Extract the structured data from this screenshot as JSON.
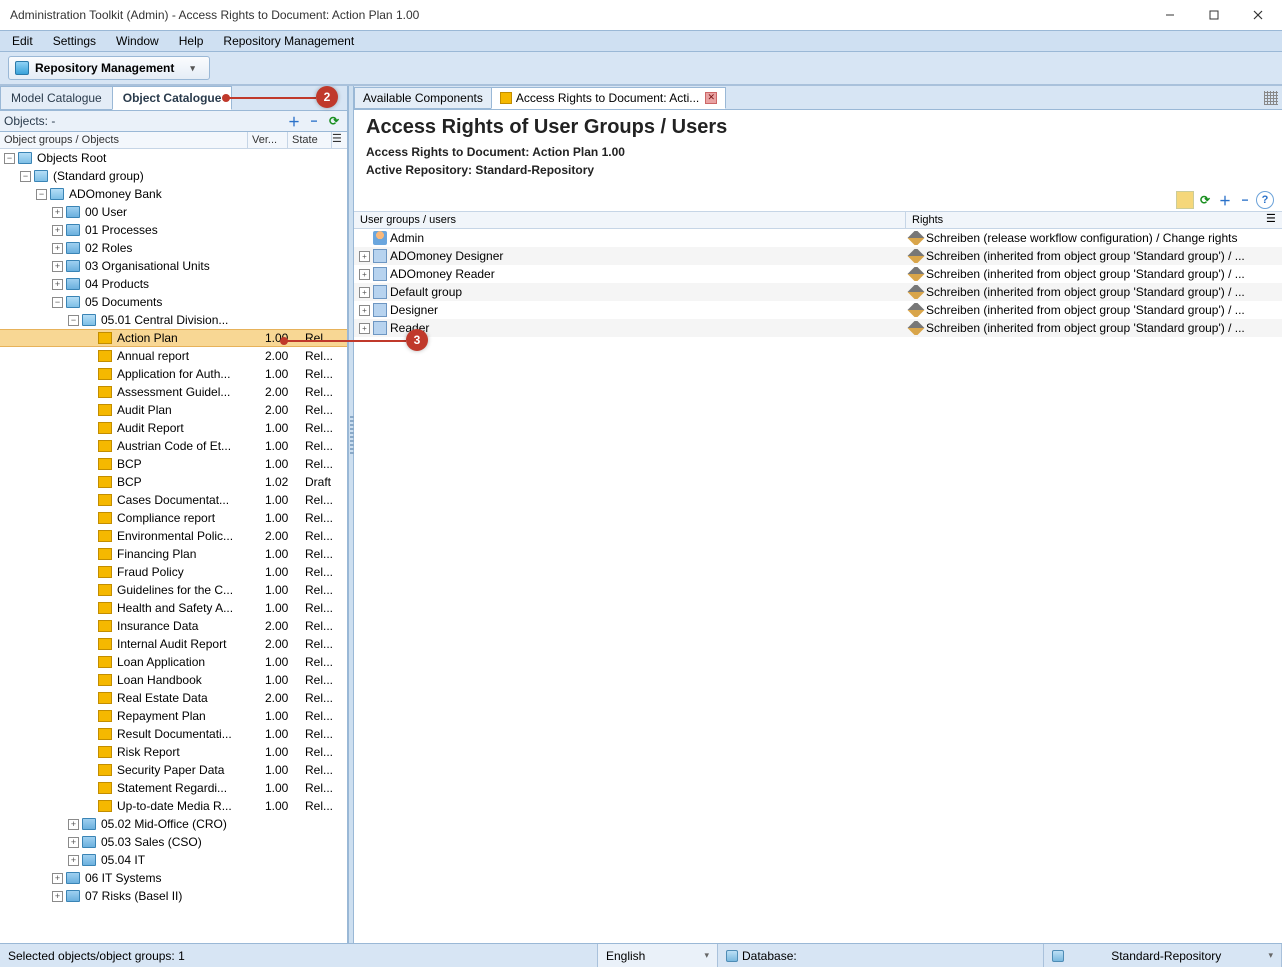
{
  "window": {
    "title": "Administration Toolkit (Admin) - Access Rights to Document: Action Plan 1.00"
  },
  "menu": {
    "items": [
      "Edit",
      "Settings",
      "Window",
      "Help",
      "Repository Management"
    ]
  },
  "toolbar": {
    "repo_btn": "Repository Management"
  },
  "left": {
    "tabs": {
      "model": "Model Catalogue",
      "object": "Object Catalogue"
    },
    "objects_label": "Objects: -",
    "header": {
      "name": "Object groups / Objects",
      "ver": "Ver...",
      "state": "State"
    },
    "tree": [
      {
        "level": 0,
        "exp": "-",
        "icon": "folder-open",
        "label": "Objects Root"
      },
      {
        "level": 1,
        "exp": "-",
        "icon": "folder-open",
        "label": "(Standard group)"
      },
      {
        "level": 2,
        "exp": "-",
        "icon": "folder-open",
        "label": "ADOmoney Bank"
      },
      {
        "level": 3,
        "exp": "+",
        "icon": "folder-closed",
        "label": "00 User"
      },
      {
        "level": 3,
        "exp": "+",
        "icon": "folder-closed",
        "label": "01 Processes"
      },
      {
        "level": 3,
        "exp": "+",
        "icon": "folder-closed",
        "label": "02 Roles"
      },
      {
        "level": 3,
        "exp": "+",
        "icon": "folder-closed",
        "label": "03 Organisational Units"
      },
      {
        "level": 3,
        "exp": "+",
        "icon": "folder-closed",
        "label": "04 Products"
      },
      {
        "level": 3,
        "exp": "-",
        "icon": "folder-open",
        "label": "05 Documents"
      },
      {
        "level": 4,
        "exp": "-",
        "icon": "folder-open",
        "label": "05.01 Central Division..."
      },
      {
        "level": 5,
        "exp": "",
        "icon": "doc",
        "label": "Action Plan",
        "ver": "1.00",
        "state": "Rel...",
        "selected": true
      },
      {
        "level": 5,
        "exp": "",
        "icon": "doc",
        "label": "Annual report",
        "ver": "2.00",
        "state": "Rel..."
      },
      {
        "level": 5,
        "exp": "",
        "icon": "doc",
        "label": "Application for Auth...",
        "ver": "1.00",
        "state": "Rel..."
      },
      {
        "level": 5,
        "exp": "",
        "icon": "doc",
        "label": "Assessment Guidel...",
        "ver": "2.00",
        "state": "Rel..."
      },
      {
        "level": 5,
        "exp": "",
        "icon": "doc",
        "label": "Audit Plan",
        "ver": "2.00",
        "state": "Rel..."
      },
      {
        "level": 5,
        "exp": "",
        "icon": "doc",
        "label": "Audit Report",
        "ver": "1.00",
        "state": "Rel..."
      },
      {
        "level": 5,
        "exp": "",
        "icon": "doc",
        "label": "Austrian Code of Et...",
        "ver": "1.00",
        "state": "Rel..."
      },
      {
        "level": 5,
        "exp": "",
        "icon": "doc",
        "label": "BCP",
        "ver": "1.00",
        "state": "Rel..."
      },
      {
        "level": 5,
        "exp": "",
        "icon": "doc",
        "label": "BCP",
        "ver": "1.02",
        "state": "Draft"
      },
      {
        "level": 5,
        "exp": "",
        "icon": "doc",
        "label": "Cases Documentat...",
        "ver": "1.00",
        "state": "Rel..."
      },
      {
        "level": 5,
        "exp": "",
        "icon": "doc",
        "label": "Compliance report",
        "ver": "1.00",
        "state": "Rel..."
      },
      {
        "level": 5,
        "exp": "",
        "icon": "doc",
        "label": "Environmental Polic...",
        "ver": "2.00",
        "state": "Rel..."
      },
      {
        "level": 5,
        "exp": "",
        "icon": "doc",
        "label": "Financing Plan",
        "ver": "1.00",
        "state": "Rel..."
      },
      {
        "level": 5,
        "exp": "",
        "icon": "doc",
        "label": "Fraud Policy",
        "ver": "1.00",
        "state": "Rel..."
      },
      {
        "level": 5,
        "exp": "",
        "icon": "doc",
        "label": "Guidelines for the C...",
        "ver": "1.00",
        "state": "Rel..."
      },
      {
        "level": 5,
        "exp": "",
        "icon": "doc",
        "label": "Health and Safety A...",
        "ver": "1.00",
        "state": "Rel..."
      },
      {
        "level": 5,
        "exp": "",
        "icon": "doc",
        "label": "Insurance Data",
        "ver": "2.00",
        "state": "Rel..."
      },
      {
        "level": 5,
        "exp": "",
        "icon": "doc",
        "label": "Internal Audit Report",
        "ver": "2.00",
        "state": "Rel..."
      },
      {
        "level": 5,
        "exp": "",
        "icon": "doc",
        "label": "Loan Application",
        "ver": "1.00",
        "state": "Rel..."
      },
      {
        "level": 5,
        "exp": "",
        "icon": "doc",
        "label": "Loan Handbook",
        "ver": "1.00",
        "state": "Rel..."
      },
      {
        "level": 5,
        "exp": "",
        "icon": "doc",
        "label": "Real Estate Data",
        "ver": "2.00",
        "state": "Rel..."
      },
      {
        "level": 5,
        "exp": "",
        "icon": "doc",
        "label": "Repayment Plan",
        "ver": "1.00",
        "state": "Rel..."
      },
      {
        "level": 5,
        "exp": "",
        "icon": "doc",
        "label": "Result Documentati...",
        "ver": "1.00",
        "state": "Rel..."
      },
      {
        "level": 5,
        "exp": "",
        "icon": "doc",
        "label": "Risk Report",
        "ver": "1.00",
        "state": "Rel..."
      },
      {
        "level": 5,
        "exp": "",
        "icon": "doc",
        "label": "Security Paper Data",
        "ver": "1.00",
        "state": "Rel..."
      },
      {
        "level": 5,
        "exp": "",
        "icon": "doc",
        "label": "Statement Regardi...",
        "ver": "1.00",
        "state": "Rel..."
      },
      {
        "level": 5,
        "exp": "",
        "icon": "doc",
        "label": "Up-to-date Media R...",
        "ver": "1.00",
        "state": "Rel..."
      },
      {
        "level": 4,
        "exp": "+",
        "icon": "folder-closed",
        "label": "05.02 Mid-Office (CRO)"
      },
      {
        "level": 4,
        "exp": "+",
        "icon": "folder-closed",
        "label": "05.03 Sales (CSO)"
      },
      {
        "level": 4,
        "exp": "+",
        "icon": "folder-closed",
        "label": "05.04 IT"
      },
      {
        "level": 3,
        "exp": "+",
        "icon": "folder-closed",
        "label": "06 IT Systems"
      },
      {
        "level": 3,
        "exp": "+",
        "icon": "folder-closed",
        "label": "07 Risks (Basel II)"
      }
    ]
  },
  "right": {
    "tabs": {
      "available": "Available Components",
      "active": "Access Rights to Document: Acti..."
    },
    "heading": "Access Rights of User Groups / Users",
    "sub1": "Access Rights to Document: Action Plan 1.00",
    "sub2": "Active Repository: Standard-Repository",
    "cols": {
      "u": "User groups / users",
      "r": "Rights"
    },
    "rows": [
      {
        "exp": "",
        "icon": "person",
        "name": "Admin",
        "rights": "Schreiben (release workflow configuration) / Change rights"
      },
      {
        "exp": "+",
        "icon": "group",
        "name": "ADOmoney Designer",
        "rights": "Schreiben (inherited from object group 'Standard group') / ..."
      },
      {
        "exp": "+",
        "icon": "group",
        "name": "ADOmoney Reader",
        "rights": "Schreiben (inherited from object group 'Standard group') / ..."
      },
      {
        "exp": "+",
        "icon": "group",
        "name": "Default group",
        "rights": "Schreiben (inherited from object group 'Standard group') / ..."
      },
      {
        "exp": "+",
        "icon": "group",
        "name": "Designer",
        "rights": "Schreiben (inherited from object group 'Standard group') / ..."
      },
      {
        "exp": "+",
        "icon": "group",
        "name": "Reader",
        "rights": "Schreiben (inherited from object group 'Standard group') / ..."
      }
    ]
  },
  "status": {
    "selection": "Selected objects/object groups: 1",
    "language": "English",
    "database_label": "Database:",
    "repository": "Standard-Repository"
  },
  "annotations": {
    "two": "2",
    "three": "3"
  }
}
